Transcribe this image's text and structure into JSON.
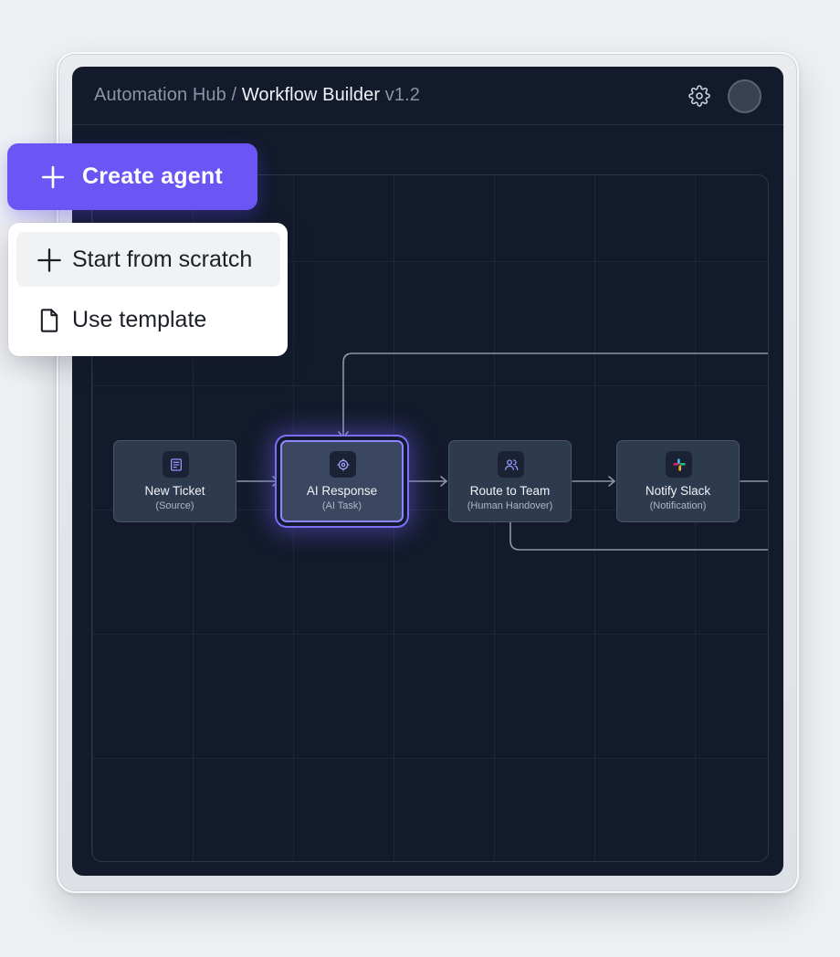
{
  "header": {
    "breadcrumb_parent": "Automation Hub",
    "separator": " / ",
    "breadcrumb_current": "Workflow Builder",
    "version": "v1.2",
    "settings_icon": "gear-icon",
    "avatar": "user-avatar"
  },
  "create_button": {
    "label": "Create agent",
    "icon": "plus-icon",
    "color": "#6b55f5"
  },
  "create_menu": {
    "items": [
      {
        "label": "Start from scratch",
        "icon": "plus-icon",
        "highlighted": true
      },
      {
        "label": "Use template",
        "icon": "document-icon",
        "highlighted": false
      }
    ]
  },
  "workflow": {
    "nodes": [
      {
        "title": "New Ticket",
        "subtitle": "(Source)",
        "icon": "form-icon",
        "selected": false
      },
      {
        "title": "AI Response",
        "subtitle": "(AI Task)",
        "icon": "ai-brain-icon",
        "selected": true
      },
      {
        "title": "Route to Team",
        "subtitle": "(Human Handover)",
        "icon": "users-icon",
        "selected": false
      },
      {
        "title": "Notify Slack",
        "subtitle": "(Notification)",
        "icon": "slack-icon",
        "selected": false
      }
    ],
    "run_button_icon": "play-icon",
    "accent_color": "#7b6ff7"
  }
}
